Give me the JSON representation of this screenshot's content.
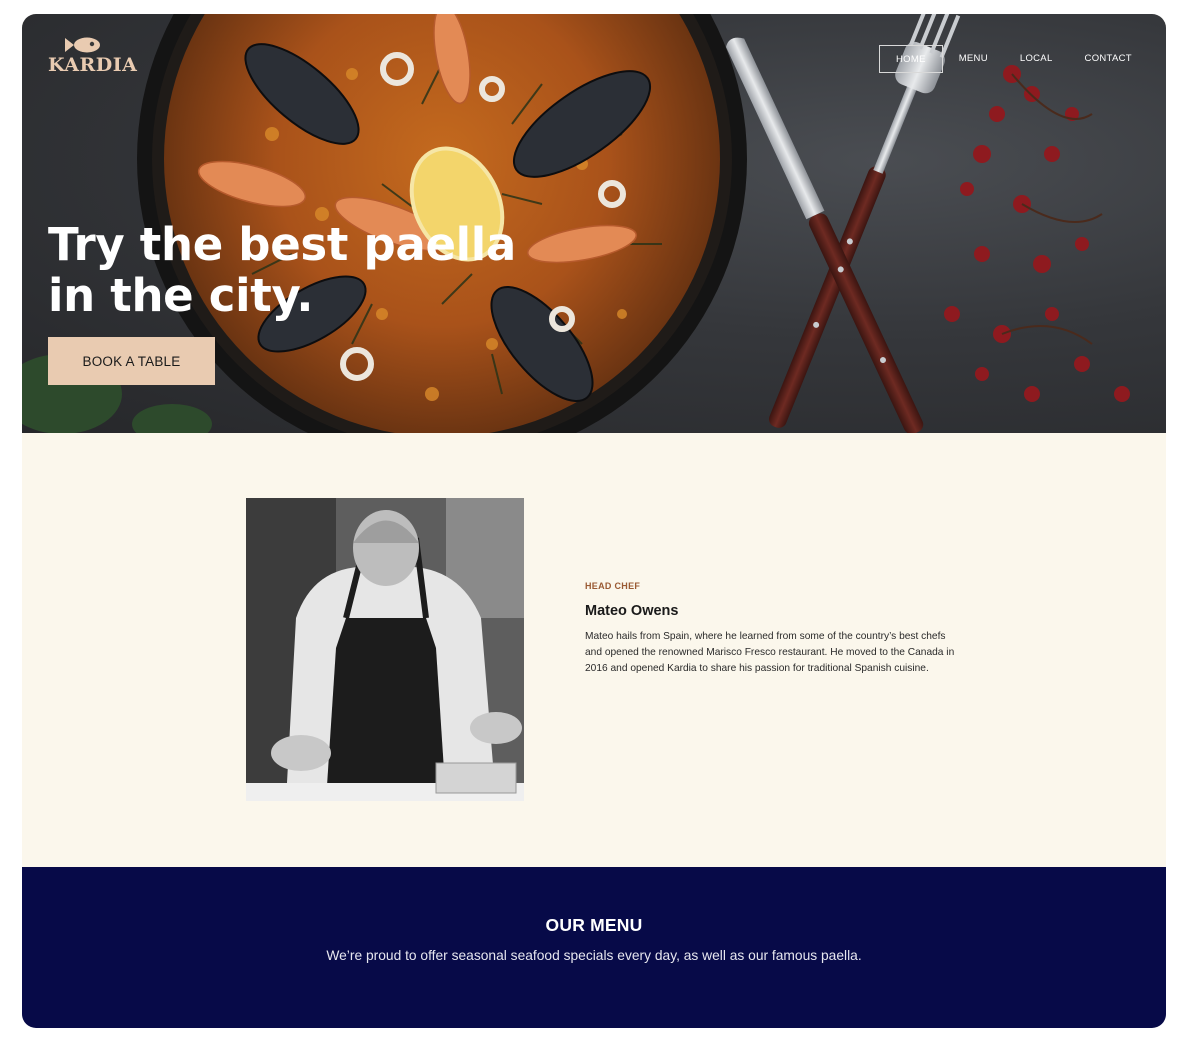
{
  "brand": {
    "name": "KARDIA",
    "logo_color": "#e9cbb1"
  },
  "nav": {
    "items": [
      {
        "label": "HOME",
        "active": true
      },
      {
        "label": "MENU",
        "active": false
      },
      {
        "label": "LOCAL",
        "active": false
      },
      {
        "label": "CONTACT",
        "active": false
      }
    ]
  },
  "hero": {
    "title_line1": "Try the best paella",
    "title_line2": "in the city.",
    "cta_label": "BOOK A TABLE",
    "cta_color": "#e9cbb1"
  },
  "chef": {
    "role": "HEAD CHEF",
    "name": "Mateo Owens",
    "bio": "Mateo hails from Spain, where he learned from some of the country’s best chefs and opened the renowned Marisco Fresco restaurant. He moved to the Canada in 2016 and opened Kardia to share his passion for traditional Spanish cuisine."
  },
  "menu": {
    "title": "OUR MENU",
    "text": "We’re proud to offer seasonal seafood specials every day, as well as our famous paella.",
    "background": "#070a48"
  },
  "colors": {
    "page_bg": "#fbf7ec",
    "accent": "#9a5a33"
  }
}
